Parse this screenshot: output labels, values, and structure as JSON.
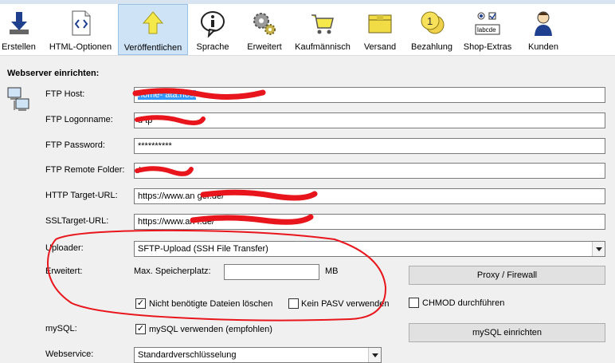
{
  "toolbar": {
    "items": [
      {
        "label": "Erstellen",
        "icon": "download-arrow-icon"
      },
      {
        "label": "HTML-Optionen",
        "icon": "code-brackets-icon"
      },
      {
        "label": "Veröffentlichen",
        "icon": "upload-arrow-icon",
        "active": true
      },
      {
        "label": "Sprache",
        "icon": "info-speech-icon"
      },
      {
        "label": "Erweitert",
        "icon": "gears-icon"
      },
      {
        "label": "Kaufmännisch",
        "icon": "shopping-cart-icon"
      },
      {
        "label": "Versand",
        "icon": "package-icon"
      },
      {
        "label": "Bezahlung",
        "icon": "coins-icon"
      },
      {
        "label": "Shop-Extras",
        "icon": "form-controls-icon"
      },
      {
        "label": "Kunden",
        "icon": "customer-icon"
      }
    ],
    "icon_caption": "labcde"
  },
  "section": {
    "title": "Webserver einrichten:"
  },
  "form": {
    "ftp_host": {
      "label": "FTP Host:",
      "value": "home-        ata.host"
    },
    "ftp_logon": {
      "label": "FTP Logonname:",
      "value": "u              tp"
    },
    "ftp_password": {
      "label": "FTP Password:",
      "value": "**********"
    },
    "ftp_remote_folder": {
      "label": "FTP Remote Folder:",
      "value": "/               "
    },
    "http_target": {
      "label": "HTTP Target-URL:",
      "value": "https://www.an                                ger.de/"
    },
    "ssl_target": {
      "label": "SSLTarget-URL:",
      "value": "https://www.an                              r.de/"
    },
    "uploader": {
      "label": "Uploader:",
      "value": "SFTP-Upload (SSH File Transfer)"
    },
    "erweitert": {
      "label": "Erweitert:",
      "speicher_label": "Max. Speicherplatz:",
      "speicher_value": "",
      "unit": "MB",
      "delete_label": "Nicht benötigte Dateien löschen",
      "delete_checked": true,
      "pasv_label": "Kein PASV verwenden",
      "pasv_checked": false,
      "chmod_label": "CHMOD durchführen",
      "chmod_checked": false
    },
    "mysql": {
      "label": "mySQL:",
      "use_label": "mySQL verwenden (empfohlen)",
      "checked": true
    },
    "webservice": {
      "label": "Webservice:",
      "value": "Standardverschlüsselung"
    }
  },
  "buttons": {
    "proxy": "Proxy / Firewall",
    "mysql_setup": "mySQL einrichten"
  },
  "colors": {
    "annotation_red": "#e8161c",
    "selection_blue": "#3399ff",
    "active_tab_bg": "#cfe3f7"
  }
}
